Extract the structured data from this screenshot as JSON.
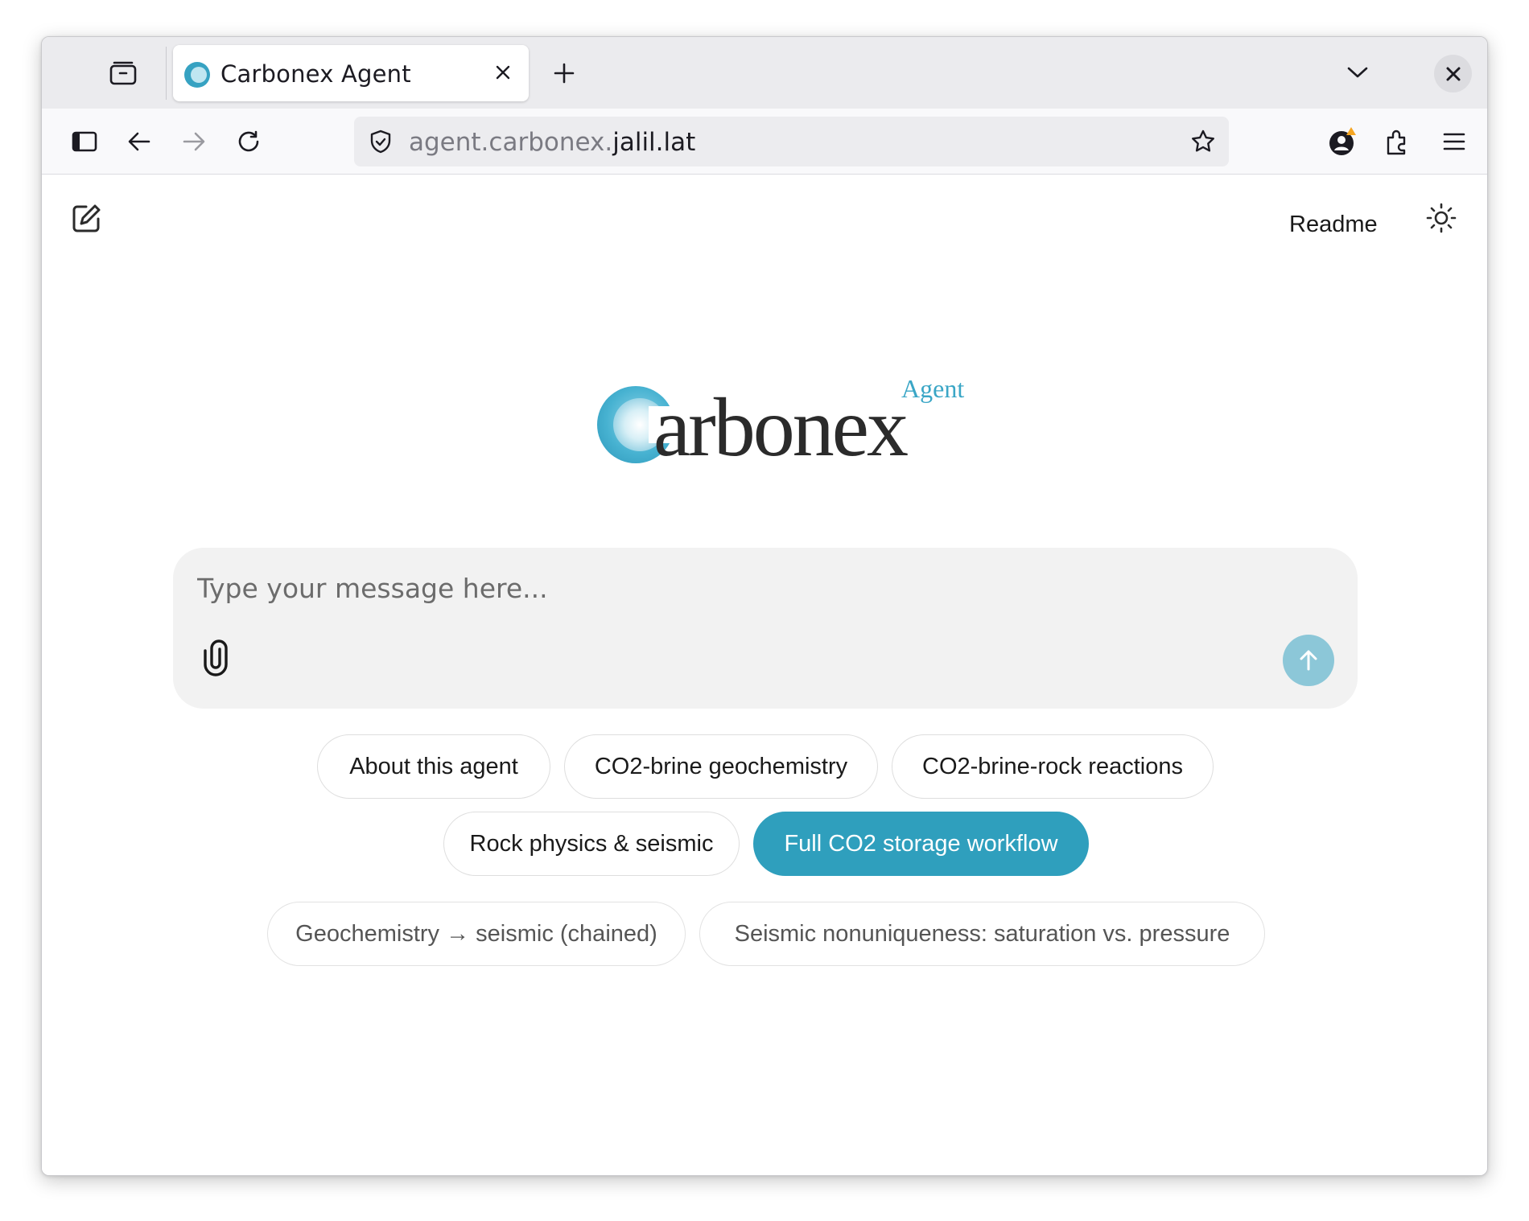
{
  "browser": {
    "tab": {
      "title": "Carbonex Agent",
      "favicon": "carbonex-c-logo",
      "close_icon": "close-icon"
    },
    "new_tab_icon": "plus-icon",
    "tab_list_icon": "chevron-down-icon",
    "window_close_icon": "close-icon",
    "nav": {
      "sidebar_icon": "sidebar-toggle-icon",
      "back_icon": "arrow-left-icon",
      "forward_icon": "arrow-right-icon",
      "reload_icon": "reload-icon"
    },
    "url": {
      "prefix": "agent.carbonex.",
      "domain": "jalil.lat"
    },
    "toolbar_icons": [
      "account-icon",
      "extensions-icon",
      "menu-icon"
    ]
  },
  "page": {
    "new_chat_icon": "edit-icon",
    "readme_label": "Readme",
    "theme_icon": "sun-icon",
    "logo": {
      "word": "arbonex",
      "badge": "Agent",
      "brand_color": "#3aa6c6"
    },
    "composer": {
      "placeholder": "Type your message here...",
      "attach_icon": "paperclip-icon",
      "send_icon": "arrow-up-icon"
    },
    "suggestions": {
      "row1": [
        "About this agent",
        "CO2-brine geochemistry",
        "CO2-brine-rock reactions"
      ],
      "row2": [
        "Rock physics & seismic",
        "Full CO2 storage workflow"
      ],
      "row3": [
        "Geochemistry → seismic (chained)",
        "Seismic nonuniqueness: saturation vs. pressure"
      ]
    },
    "colors": {
      "accent": "#2f9fbd",
      "send_button": "#8cc7d8"
    }
  }
}
